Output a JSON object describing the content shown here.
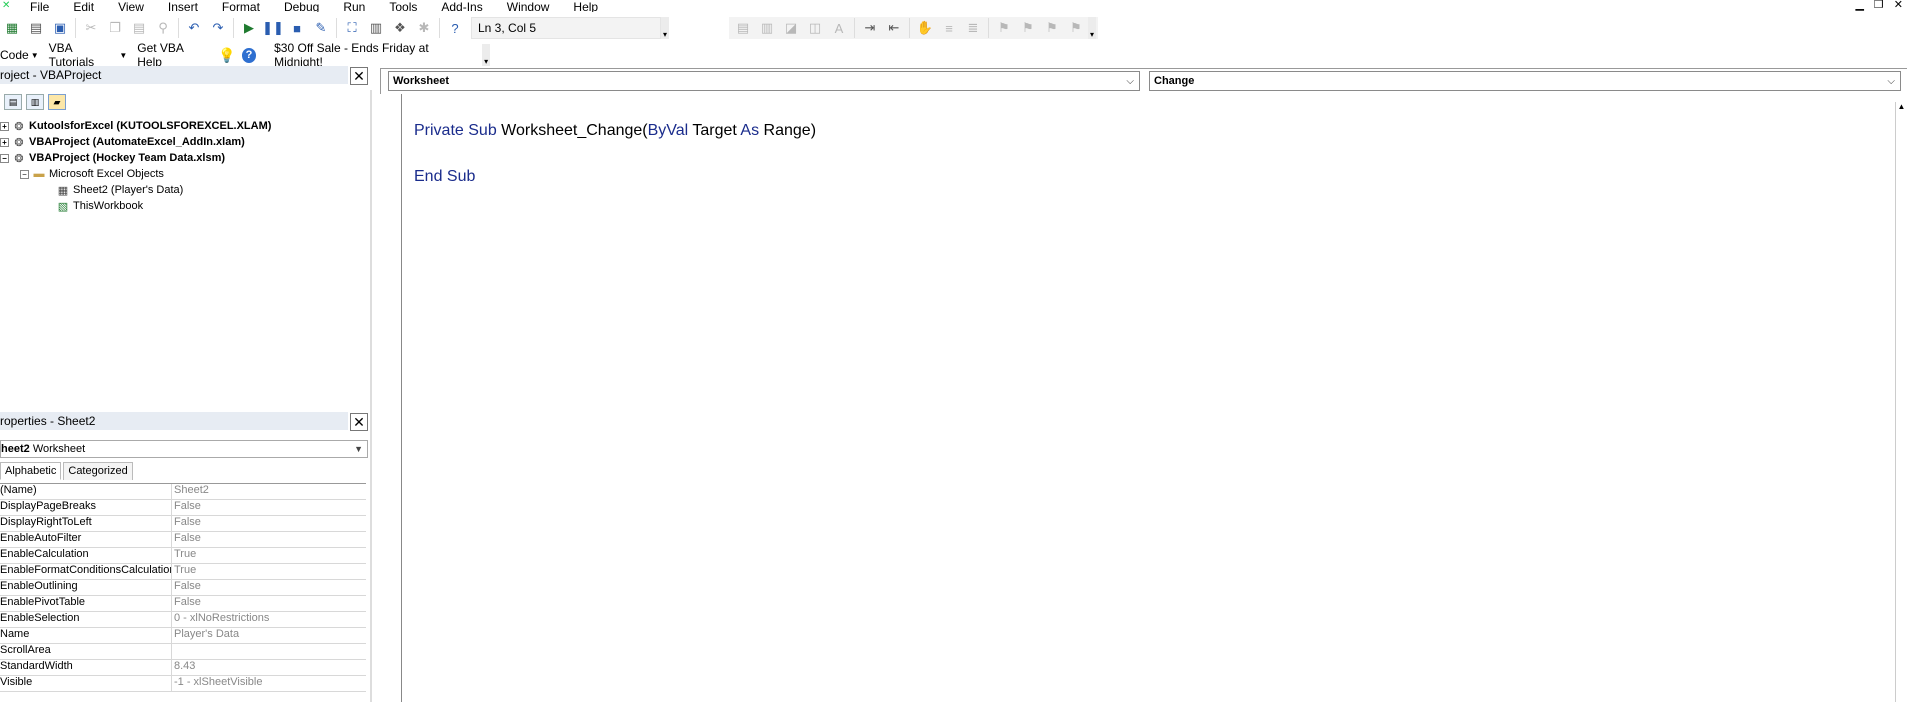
{
  "menu": {
    "items": [
      "File",
      "Edit",
      "View",
      "Insert",
      "Format",
      "Debug",
      "Run",
      "Tools",
      "Add-Ins",
      "Window",
      "Help"
    ],
    "mnemonics": [
      "F",
      "E",
      "V",
      "I",
      "o",
      "D",
      "R",
      "T",
      "A",
      "W",
      "H"
    ]
  },
  "status": {
    "position": "Ln 3, Col 5"
  },
  "toolbar2": {
    "code": "Code",
    "vba_tutorials": "VBA Tutorials",
    "vba_help": "Get VBA Help",
    "promo": "$30 Off Sale - Ends Friday at Midnight!"
  },
  "project": {
    "title": "roject - VBAProject",
    "tree": [
      {
        "label": "KutoolsforExcel (KUTOOLSFOREXCEL.XLAM)",
        "bold": true
      },
      {
        "label": "VBAProject (AutomateExcel_AddIn.xlam)",
        "bold": true
      },
      {
        "label": "VBAProject (Hockey Team Data.xlsm)",
        "bold": true
      },
      {
        "label": "Microsoft Excel Objects",
        "bold": false
      },
      {
        "label": "Sheet2 (Player's Data)",
        "bold": false
      },
      {
        "label": "ThisWorkbook",
        "bold": false
      }
    ]
  },
  "properties": {
    "title": "roperties - Sheet2",
    "object_name": "heet2",
    "object_type": "Worksheet",
    "tabs": [
      "Alphabetic",
      "Categorized"
    ],
    "rows": [
      {
        "key": "(Name)",
        "value": "Sheet2"
      },
      {
        "key": "DisplayPageBreaks",
        "value": "False"
      },
      {
        "key": "DisplayRightToLeft",
        "value": "False"
      },
      {
        "key": "EnableAutoFilter",
        "value": "False"
      },
      {
        "key": "EnableCalculation",
        "value": "True"
      },
      {
        "key": "EnableFormatConditionsCalculation",
        "value": "True"
      },
      {
        "key": "EnableOutlining",
        "value": "False"
      },
      {
        "key": "EnablePivotTable",
        "value": "False"
      },
      {
        "key": "EnableSelection",
        "value": "0 - xlNoRestrictions"
      },
      {
        "key": "Name",
        "value": "Player's Data"
      },
      {
        "key": "ScrollArea",
        "value": ""
      },
      {
        "key": "StandardWidth",
        "value": "8.43"
      },
      {
        "key": "Visible",
        "value": "-1 - xlSheetVisible"
      }
    ]
  },
  "code": {
    "object_combo": "Worksheet",
    "proc_combo": "Change",
    "line1": {
      "private": "Private",
      "sub": "Sub",
      "name": "Worksheet_Change(",
      "byval": "ByVal",
      "target": "Target",
      "as": "As",
      "rest": "Range)"
    },
    "line3": "End Sub"
  }
}
